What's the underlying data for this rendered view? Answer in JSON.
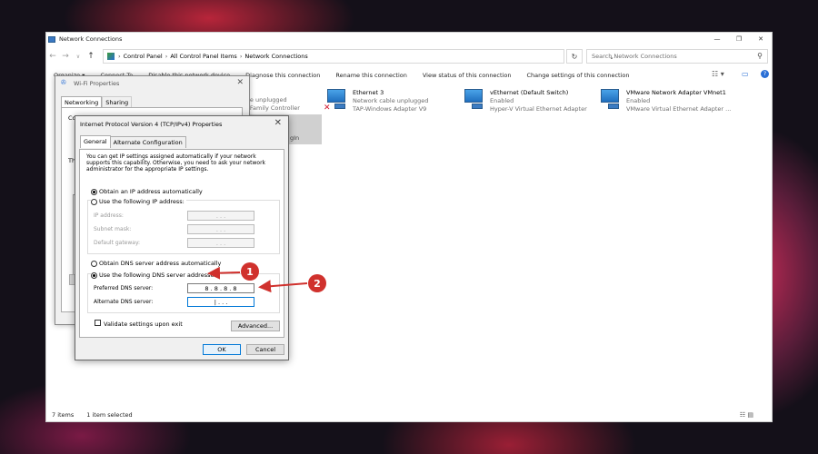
{
  "window": {
    "title": "Network Connections",
    "controls": {
      "minimize": "—",
      "maximize": "❐",
      "close": "✕"
    }
  },
  "address": {
    "back": "←",
    "forward": "→",
    "recent": "∨",
    "up": "↑",
    "breadcrumbs": [
      "Control Panel",
      "All Control Panel Items",
      "Network Connections"
    ],
    "separator": "›",
    "dropdown": "⌄",
    "refresh": "↻",
    "search_placeholder": "Search Network Connections",
    "search_icon": "⚲"
  },
  "commands": [
    "Organize ▾",
    "Connect To",
    "Disable this network device",
    "Diagnose this connection",
    "Rename this connection",
    "View status of this connection",
    "Change settings of this connection"
  ],
  "view_icons": {
    "change_view": "☷ ▾",
    "preview_pane": "▭",
    "help": "?"
  },
  "connections": [
    {
      "name": "",
      "status": "able unplugged",
      "device": "FE Family Controller",
      "error": false
    },
    {
      "name": "Ethernet 3",
      "status": "Network cable unplugged",
      "device": "TAP-Windows Adapter V9",
      "error": true
    },
    {
      "name": "vEthernet (Default Switch)",
      "status": "Enabled",
      "device": "Hyper-V Virtual Ethernet Adapter",
      "error": false
    },
    {
      "name": "VMware Network Adapter VMnet1",
      "status": "Enabled",
      "device": "VMware Virtual Ethernet Adapter ...",
      "error": false
    }
  ],
  "partial_text": {
    "wifi_gin": "gIn",
    "wifi_co": "Co",
    "wifi_th": "Th"
  },
  "statusbar": {
    "items": "7 items",
    "selected": "1 item selected",
    "view_switch": "☷ ▤"
  },
  "wifi_dialog": {
    "title": "Wi-Fi Properties",
    "icon": "✇",
    "close": "✕",
    "tabs": [
      "Networking",
      "Sharing"
    ]
  },
  "ipv4_dialog": {
    "title": "Internet Protocol Version 4 (TCP/IPv4) Properties",
    "close": "✕",
    "tabs": [
      "General",
      "Alternate Configuration"
    ],
    "description": "You can get IP settings assigned automatically if your network supports this capability. Otherwise, you need to ask your network administrator for the appropriate IP settings.",
    "ip_auto": "Obtain an IP address automatically",
    "ip_manual": "Use the following IP address:",
    "ip_fields": [
      {
        "label": "IP address:",
        "value": ".   .   ."
      },
      {
        "label": "Subnet mask:",
        "value": ".   .   ."
      },
      {
        "label": "Default gateway:",
        "value": ".   .   ."
      }
    ],
    "dns_auto": "Obtain DNS server address automatically",
    "dns_manual": "Use the following DNS server addresses:",
    "dns_fields": [
      {
        "label": "Preferred DNS server:",
        "value": "8  .  8  .  8  .  8"
      },
      {
        "label": "Alternate DNS server:",
        "value": "|   .   .   ."
      }
    ],
    "validate": "Validate settings upon exit",
    "advanced": "Advanced...",
    "ok": "OK",
    "cancel": "Cancel"
  },
  "annotations": {
    "callout_1": "1",
    "callout_2": "2",
    "color": "#d0312d"
  }
}
